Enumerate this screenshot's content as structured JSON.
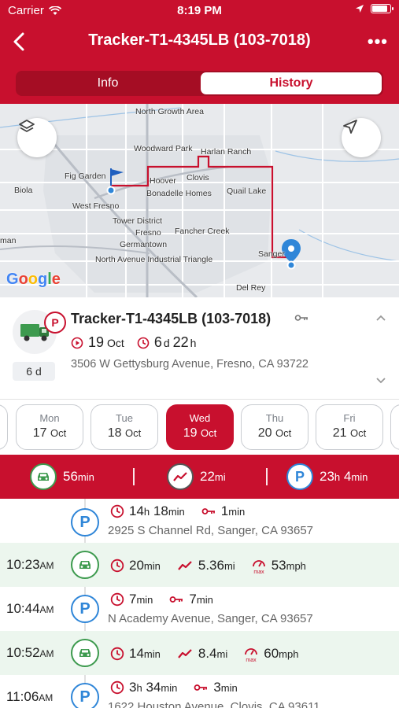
{
  "status_bar": {
    "carrier": "Carrier",
    "time": "8:19 PM",
    "battery_level": 0.9
  },
  "nav": {
    "title": "Tracker-T1-4345LB (103-7018)"
  },
  "tabs": [
    {
      "label": "Info",
      "active": false
    },
    {
      "label": "History",
      "active": true
    }
  ],
  "map": {
    "places": [
      "North Growth Area",
      "Woodward Park",
      "Harlan Ranch",
      "Fig Garden",
      "Clovis",
      "Hoover",
      "Bonadelle Homes",
      "Biola",
      "Quail Lake",
      "West Fresno",
      "Tower District",
      "Fresno",
      "Fancher Creek",
      "Germantown",
      "North Avenue Industrial Triangle",
      "Sanger",
      "Del Rey",
      "man"
    ],
    "attribution": "Google",
    "route_color": "#c8102e",
    "pin_color": "#2f86d8"
  },
  "device": {
    "name": "Tracker-T1-4345LB (103-7018)",
    "duration_badge": "6 d",
    "status_badge": "P",
    "date_day": "19",
    "date_month": "Oct",
    "elapsed_value_1": "6",
    "elapsed_unit_1": "d",
    "elapsed_value_2": "22",
    "elapsed_unit_2": "h",
    "address": "3506 W Gettysburg Avenue, Fresno, CA 93722"
  },
  "days": [
    {
      "weekday": "Mon",
      "day": "17",
      "month": "Oct",
      "selected": false
    },
    {
      "weekday": "Tue",
      "day": "18",
      "month": "Oct",
      "selected": false
    },
    {
      "weekday": "Wed",
      "day": "19",
      "month": "Oct",
      "selected": true
    },
    {
      "weekday": "Thu",
      "day": "20",
      "month": "Oct",
      "selected": false
    },
    {
      "weekday": "Fri",
      "day": "21",
      "month": "Oct",
      "selected": false
    }
  ],
  "summary": {
    "drive_value": "56",
    "drive_unit": "min",
    "distance_value": "22",
    "distance_unit": "mi",
    "park_value_1": "23",
    "park_unit_1": "h",
    "park_value_2": "4",
    "park_unit_2": "min"
  },
  "timeline": [
    {
      "type": "park",
      "time": "",
      "ampm": "",
      "dur_1": "14",
      "dur_unit_1": "h",
      "dur_2": "18",
      "dur_unit_2": "min",
      "key_value": "1",
      "key_unit": "min",
      "address": "2925 S Channel Rd, Sanger, CA 93657"
    },
    {
      "type": "drive",
      "time": "10:23",
      "ampm": "AM",
      "dur_value": "20",
      "dur_unit": "min",
      "dist_value": "5.36",
      "dist_unit": "mi",
      "max_speed": "53",
      "speed_unit": "mph",
      "max_label": "max"
    },
    {
      "type": "park",
      "time": "10:44",
      "ampm": "AM",
      "dur_1": "7",
      "dur_unit_1": "min",
      "dur_2": "",
      "dur_unit_2": "",
      "key_value": "7",
      "key_unit": "min",
      "address": "N Academy Avenue, Sanger, CA 93657"
    },
    {
      "type": "drive",
      "time": "10:52",
      "ampm": "AM",
      "dur_value": "14",
      "dur_unit": "min",
      "dist_value": "8.4",
      "dist_unit": "mi",
      "max_speed": "60",
      "speed_unit": "mph",
      "max_label": "max"
    },
    {
      "type": "park",
      "time": "11:06",
      "ampm": "AM",
      "dur_1": "3",
      "dur_unit_1": "h",
      "dur_2": "34",
      "dur_unit_2": "min",
      "key_value": "3",
      "key_unit": "min",
      "address": "1622 Houston Avenue, Clovis, CA 93611"
    }
  ]
}
